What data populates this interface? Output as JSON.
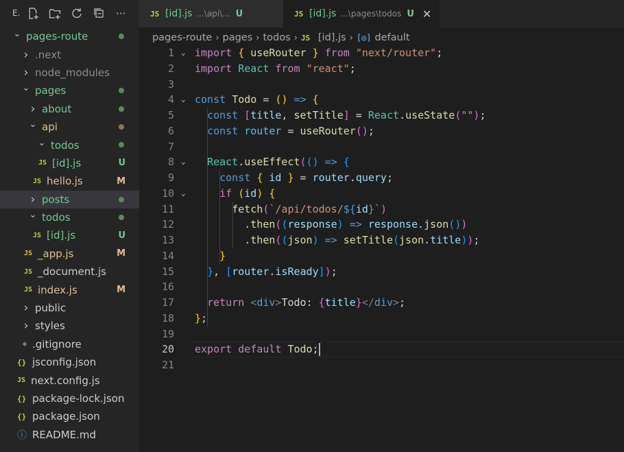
{
  "sidebar": {
    "toolbar_label": "E.",
    "tree": [
      {
        "label": "pages-route",
        "indent": 0,
        "type": "folder-open",
        "dot": "green",
        "color": "green"
      },
      {
        "label": ".next",
        "indent": 1,
        "type": "folder",
        "color": "dim"
      },
      {
        "label": "node_modules",
        "indent": 1,
        "type": "folder",
        "color": "dim"
      },
      {
        "label": "pages",
        "indent": 1,
        "type": "folder-open",
        "dot": "green",
        "color": "green"
      },
      {
        "label": "about",
        "indent": 2,
        "type": "folder",
        "dot": "green",
        "color": "green"
      },
      {
        "label": "api",
        "indent": 2,
        "type": "folder-open",
        "dot": "brown",
        "color": "yellow"
      },
      {
        "label": "todos",
        "indent": 3,
        "type": "folder-open",
        "dot": "green",
        "color": "green"
      },
      {
        "label": "[id].js",
        "indent": 4,
        "type": "js",
        "status": "U",
        "color": "green"
      },
      {
        "label": "hello.js",
        "indent": 3,
        "type": "js",
        "status": "M",
        "color": "yellow"
      },
      {
        "label": "posts",
        "indent": 2,
        "type": "folder",
        "dot": "green",
        "color": "green",
        "selected": true
      },
      {
        "label": "todos",
        "indent": 2,
        "type": "folder-open",
        "dot": "green",
        "color": "green"
      },
      {
        "label": "[id].js",
        "indent": 3,
        "type": "js",
        "status": "U",
        "color": "green"
      },
      {
        "label": "_app.js",
        "indent": 2,
        "type": "js",
        "status": "M",
        "color": "yellow"
      },
      {
        "label": "_document.js",
        "indent": 2,
        "type": "js",
        "color": "normal"
      },
      {
        "label": "index.js",
        "indent": 2,
        "type": "js",
        "status": "M",
        "color": "yellow"
      },
      {
        "label": "public",
        "indent": 1,
        "type": "folder",
        "color": "normal"
      },
      {
        "label": "styles",
        "indent": 1,
        "type": "folder",
        "color": "normal"
      },
      {
        "label": ".gitignore",
        "indent": 1,
        "type": "gitignore",
        "color": "normal"
      },
      {
        "label": "jsconfig.json",
        "indent": 1,
        "type": "json",
        "color": "normal"
      },
      {
        "label": "next.config.js",
        "indent": 1,
        "type": "js",
        "color": "normal"
      },
      {
        "label": "package-lock.json",
        "indent": 1,
        "type": "json",
        "color": "normal"
      },
      {
        "label": "package.json",
        "indent": 1,
        "type": "json",
        "color": "normal"
      },
      {
        "label": "README.md",
        "indent": 1,
        "type": "info",
        "color": "normal"
      }
    ]
  },
  "tabs": [
    {
      "icon": "JS",
      "name": "[id].js",
      "path": "...\\api\\...",
      "status": "U",
      "active": false
    },
    {
      "icon": "JS",
      "name": "[id].js",
      "path": "...\\pages\\todos",
      "status": "U",
      "active": true,
      "close": "✕"
    }
  ],
  "breadcrumbs": {
    "items": [
      "pages-route",
      "pages",
      "todos"
    ],
    "file_icon": "JS",
    "file": "[id].js",
    "symbol_icon": "[◎]",
    "symbol": "default"
  },
  "editor": {
    "current_line": 20,
    "lines": [
      "import { useRouter } from \"next/router\";",
      "import React from \"react\";",
      "",
      "const Todo = () => {",
      "  const [title, setTitle] = React.useState(\"\");",
      "  const router = useRouter();",
      "",
      "  React.useEffect(() => {",
      "    const { id } = router.query;",
      "    if (id) {",
      "      fetch(`/api/todos/${id}`)",
      "        .then((response) => response.json())",
      "        .then((json) => setTitle(json.title));",
      "    }",
      "  }, [router.isReady]);",
      "",
      "  return <div>Todo: {title}</div>;",
      "};",
      "",
      "export default Todo;",
      ""
    ]
  },
  "colors": {
    "background": "#1e1e1e",
    "sidebar": "#252526",
    "keyword": "#569cd6",
    "control": "#c586c0",
    "string": "#ce9178",
    "function": "#dcdcaa",
    "variable": "#9cdcfe",
    "untracked": "#73c991",
    "modified": "#e2c08d"
  }
}
